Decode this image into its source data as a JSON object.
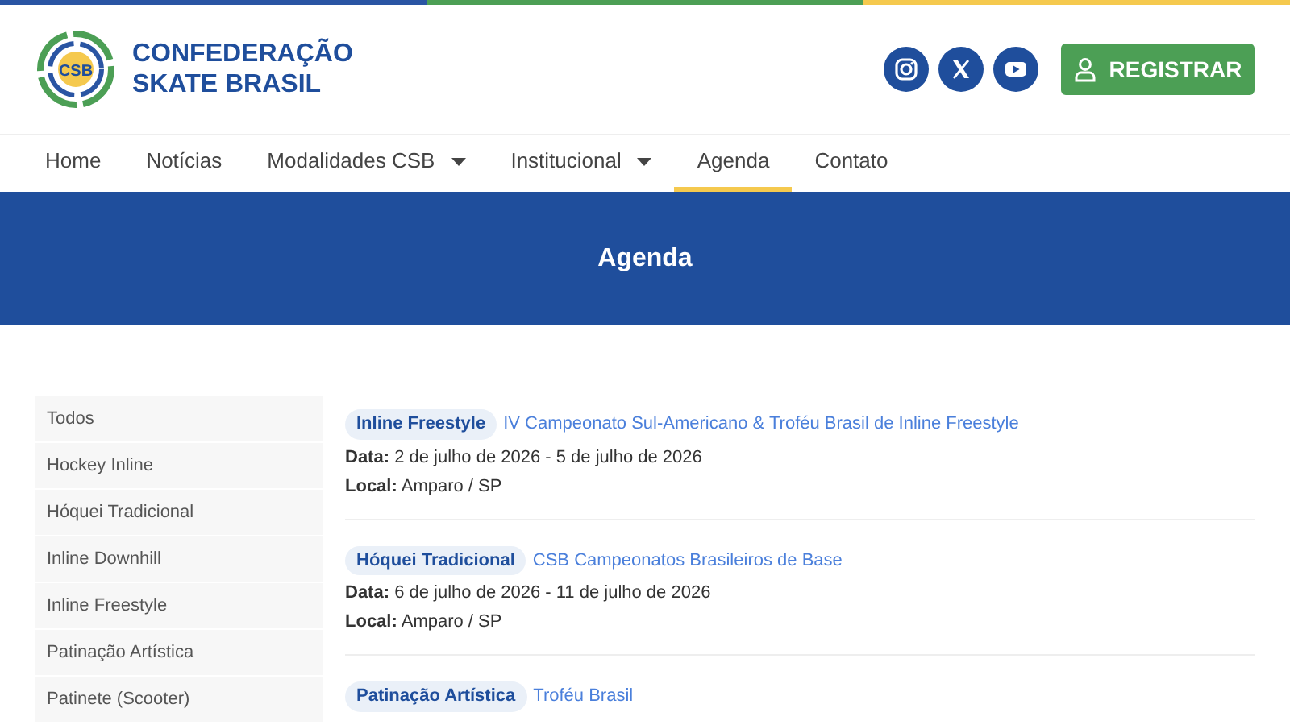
{
  "logo": {
    "badge": "CSB",
    "line_1": "CONFEDERAÇÃO",
    "line_2": "SKATE BRASIL"
  },
  "social": [
    {
      "kind": "instagram"
    },
    {
      "kind": "x"
    },
    {
      "kind": "youtube"
    }
  ],
  "register_button": "REGISTRAR",
  "nav": [
    {
      "label": "Home",
      "dropdown": false,
      "selected": false
    },
    {
      "label": "Notícias",
      "dropdown": false,
      "selected": false
    },
    {
      "label": "Modalidades CSB",
      "dropdown": true,
      "selected": false
    },
    {
      "label": "Institucional",
      "dropdown": true,
      "selected": false
    },
    {
      "label": "Agenda",
      "dropdown": false,
      "selected": true
    },
    {
      "label": "Contato",
      "dropdown": false,
      "selected": false
    }
  ],
  "banner": {
    "title": "Agenda"
  },
  "sidebar": {
    "items": [
      "Todos",
      "Hockey Inline",
      "Hóquei Tradicional",
      "Inline Downhill",
      "Inline Freestyle",
      "Patinação Artística",
      "Patinete (Scooter)"
    ]
  },
  "events": [
    {
      "tag": "Inline Freestyle",
      "title": "IV Campeonato Sul-Americano & Troféu Brasil de Inline Freestyle",
      "date_label": "Data:",
      "date": "2 de julho de 2026 - 5 de julho de 2026",
      "place_label": "Local:",
      "place": "Amparo / SP"
    },
    {
      "tag": "Hóquei Tradicional",
      "title": "CSB Campeonatos Brasileiros de Base",
      "date_label": "Data:",
      "date": "6 de julho de 2026 - 11 de julho de 2026",
      "place_label": "Local:",
      "place": "Amparo / SP"
    },
    {
      "tag": "Patinação Artística",
      "title": "Troféu Brasil"
    }
  ]
}
